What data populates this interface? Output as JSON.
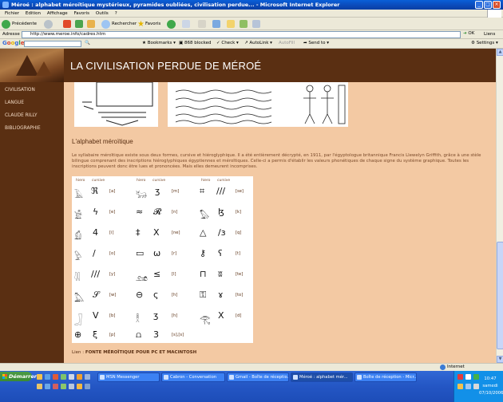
{
  "window": {
    "title": "Méroé : alphabet méroïtique mystérieux, pyramides oubliées, civilisation perdue... - Microsoft Internet Explorer"
  },
  "menu": [
    "Fichier",
    "Edition",
    "Affichage",
    "Favoris",
    "Outils",
    "?"
  ],
  "toolbar": {
    "back": "Précédente",
    "search": "Rechercher",
    "favorites": "Favoris"
  },
  "address": {
    "label": "Adresse",
    "url": "http://www.meroe.info/cadres.htm",
    "go": "OK",
    "links": "Liens"
  },
  "googlebar": {
    "brand": "Google",
    "bookmarks": "Bookmarks",
    "blocked": "868 blocked",
    "check": "Check",
    "autolink": "AutoLink",
    "autofill": "AutoFill",
    "sendto": "Send to",
    "settings": "Settings"
  },
  "site": {
    "title": "LA CIVILISATION PERDUE DE MÉROÉ",
    "nav": [
      "CIVILISATION",
      "LANGUE",
      "CLAUDE RILLY",
      "BIBLIOGRAPHIE"
    ],
    "section_title": "L'alphabet méroïtique",
    "paragraph": "Le syllabaire méroïtique existe sous deux formes, cursive et hiéroglyphique. Il a été entièrement décrypté, en 1911, par l'égyptologue britannique Francis Llewelyn Griffith, grâce à une stèle bilingue comprenant des inscriptions hiéroglyphiques égyptiennes et méroïtiques. Celle-ci a permis d'établir les valeurs phonétiques de chaque signe du système graphique. Toutes les inscriptions peuvent donc être lues et prononcées. Mais elles demeurent incomprises.",
    "table_headers": [
      "hiero",
      "cursive"
    ],
    "col1_values": [
      "[a]",
      "[e]",
      "[i]",
      "[o]",
      "[y]",
      "[w]",
      "[b]",
      "[p]"
    ],
    "col2_values": [
      "[m]",
      "[n]",
      "[ne]",
      "[r]",
      "[l]",
      "[h]",
      "[h]",
      "[s],[s]"
    ],
    "col3_values": [
      "[se]",
      "[k]",
      "[q]",
      "[t]",
      "[te]",
      "[to]",
      "[d]"
    ],
    "link_prefix": "Lien :",
    "link_text": "FONTE MÉROÏTIQUE POUR PC ET MACINTOSH"
  },
  "status": {
    "zone": "Internet"
  },
  "taskbar": {
    "start": "Démarrer",
    "tasks": [
      "MSN Messenger",
      "Cabron - Conversation",
      "Gmail - Boîte de réceptio...",
      "Méroé : alphabet mér...",
      "Boîte de réception - Micr..."
    ],
    "clock_time": "10:47",
    "clock_day": "samedi",
    "clock_date": "07/10/2006"
  }
}
